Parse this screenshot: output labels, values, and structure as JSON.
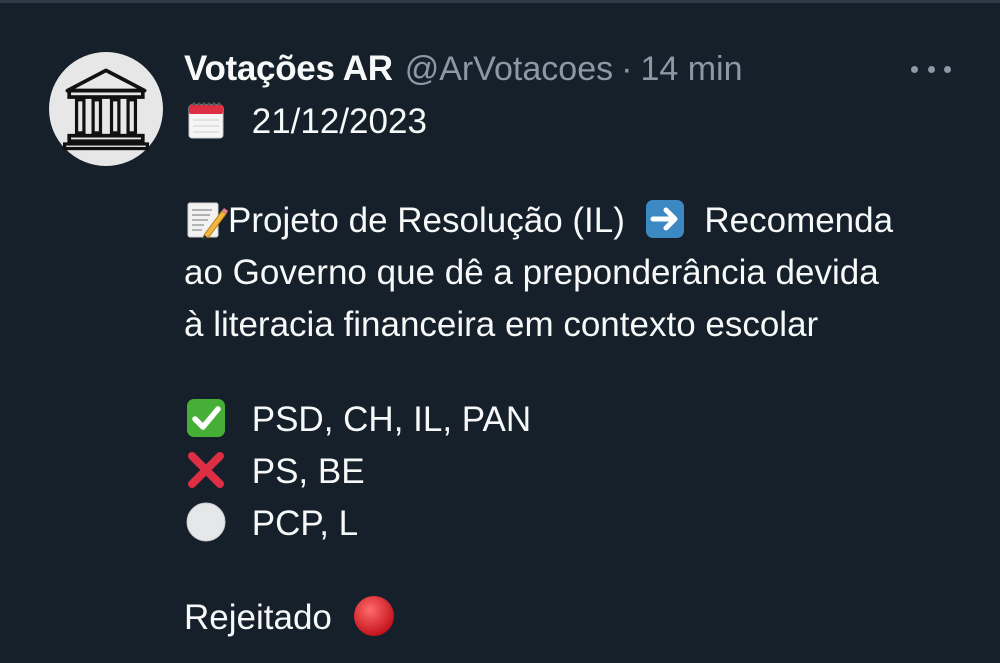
{
  "tweet": {
    "display_name": "Votações AR",
    "handle": "@ArVotacoes",
    "separator": "·",
    "timestamp": "14 min",
    "date": "21/12/2023",
    "title_line1": "Projeto de Resolução (IL)",
    "title_line1_rest": "Recomenda",
    "title_line2": "ao Governo que dê a preponderância devida",
    "title_line3": "à literacia financeira em contexto escolar",
    "votes_for": "PSD, CH, IL, PAN",
    "votes_against": "PS, BE",
    "votes_abstain": "PCP, L",
    "result": "Rejeitado"
  },
  "icons": {
    "avatar": "courthouse-icon",
    "more": "more-options-icon",
    "calendar": "calendar-icon",
    "memo": "memo-icon",
    "arrow": "right-arrow-icon",
    "check": "check-mark-icon",
    "cross": "cross-mark-icon",
    "white_circle": "white-circle-icon",
    "red_circle": "red-circle-icon"
  },
  "colors": {
    "background": "#15202b",
    "text": "#f7f9f9",
    "muted": "#8b98a5",
    "check_green": "#45b035",
    "cross_red": "#dd2e44",
    "arrow_blue": "#3b88c3"
  }
}
